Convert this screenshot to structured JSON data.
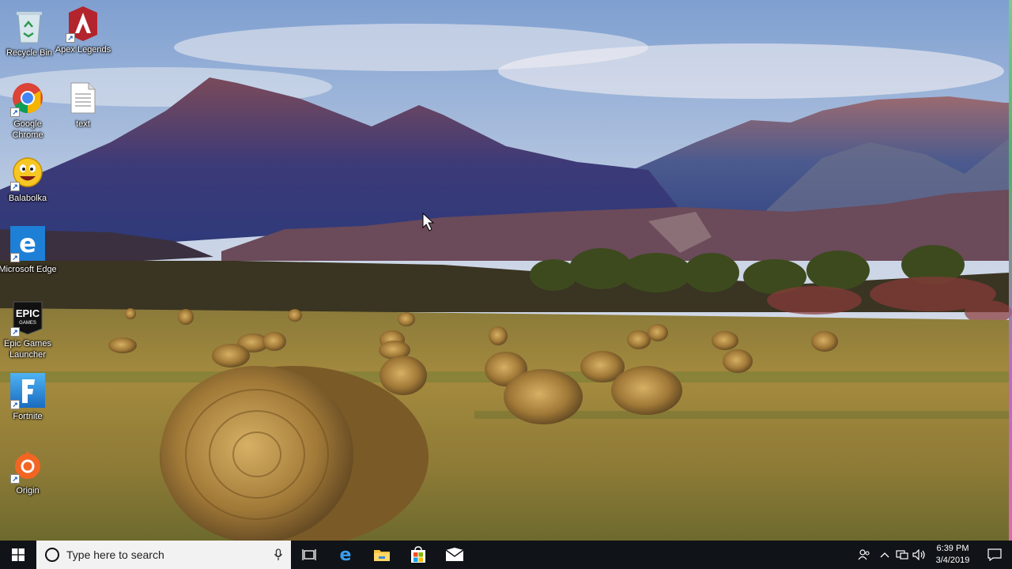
{
  "desktop": {
    "icons": [
      {
        "label": "Recycle Bin",
        "icon": "recycle-bin-icon"
      },
      {
        "label": "Apex Legends",
        "icon": "apex-legends-icon"
      },
      {
        "label": "Google Chrome",
        "icon": "chrome-icon"
      },
      {
        "label": "text",
        "icon": "text-document-icon"
      },
      {
        "label": "Balabolka",
        "icon": "balabolka-icon"
      },
      {
        "label": "Microsoft Edge",
        "icon": "edge-icon"
      },
      {
        "label": "Epic Games Launcher",
        "icon": "epic-games-icon",
        "badge": "EPIC GAMES"
      },
      {
        "label": "Fortnite",
        "icon": "fortnite-icon",
        "badge": "F"
      },
      {
        "label": "Origin",
        "icon": "origin-icon"
      }
    ]
  },
  "taskbar": {
    "search_placeholder": "Type here to search",
    "pinned": [
      "task-view-icon",
      "edge-icon",
      "file-explorer-icon",
      "store-icon",
      "mail-icon"
    ],
    "clock": {
      "time": "6:39 PM",
      "date": "3/4/2019"
    }
  },
  "colors": {
    "taskbar": "#101318",
    "search_bg": "#f2f2f2",
    "accent": "#0078d7"
  }
}
